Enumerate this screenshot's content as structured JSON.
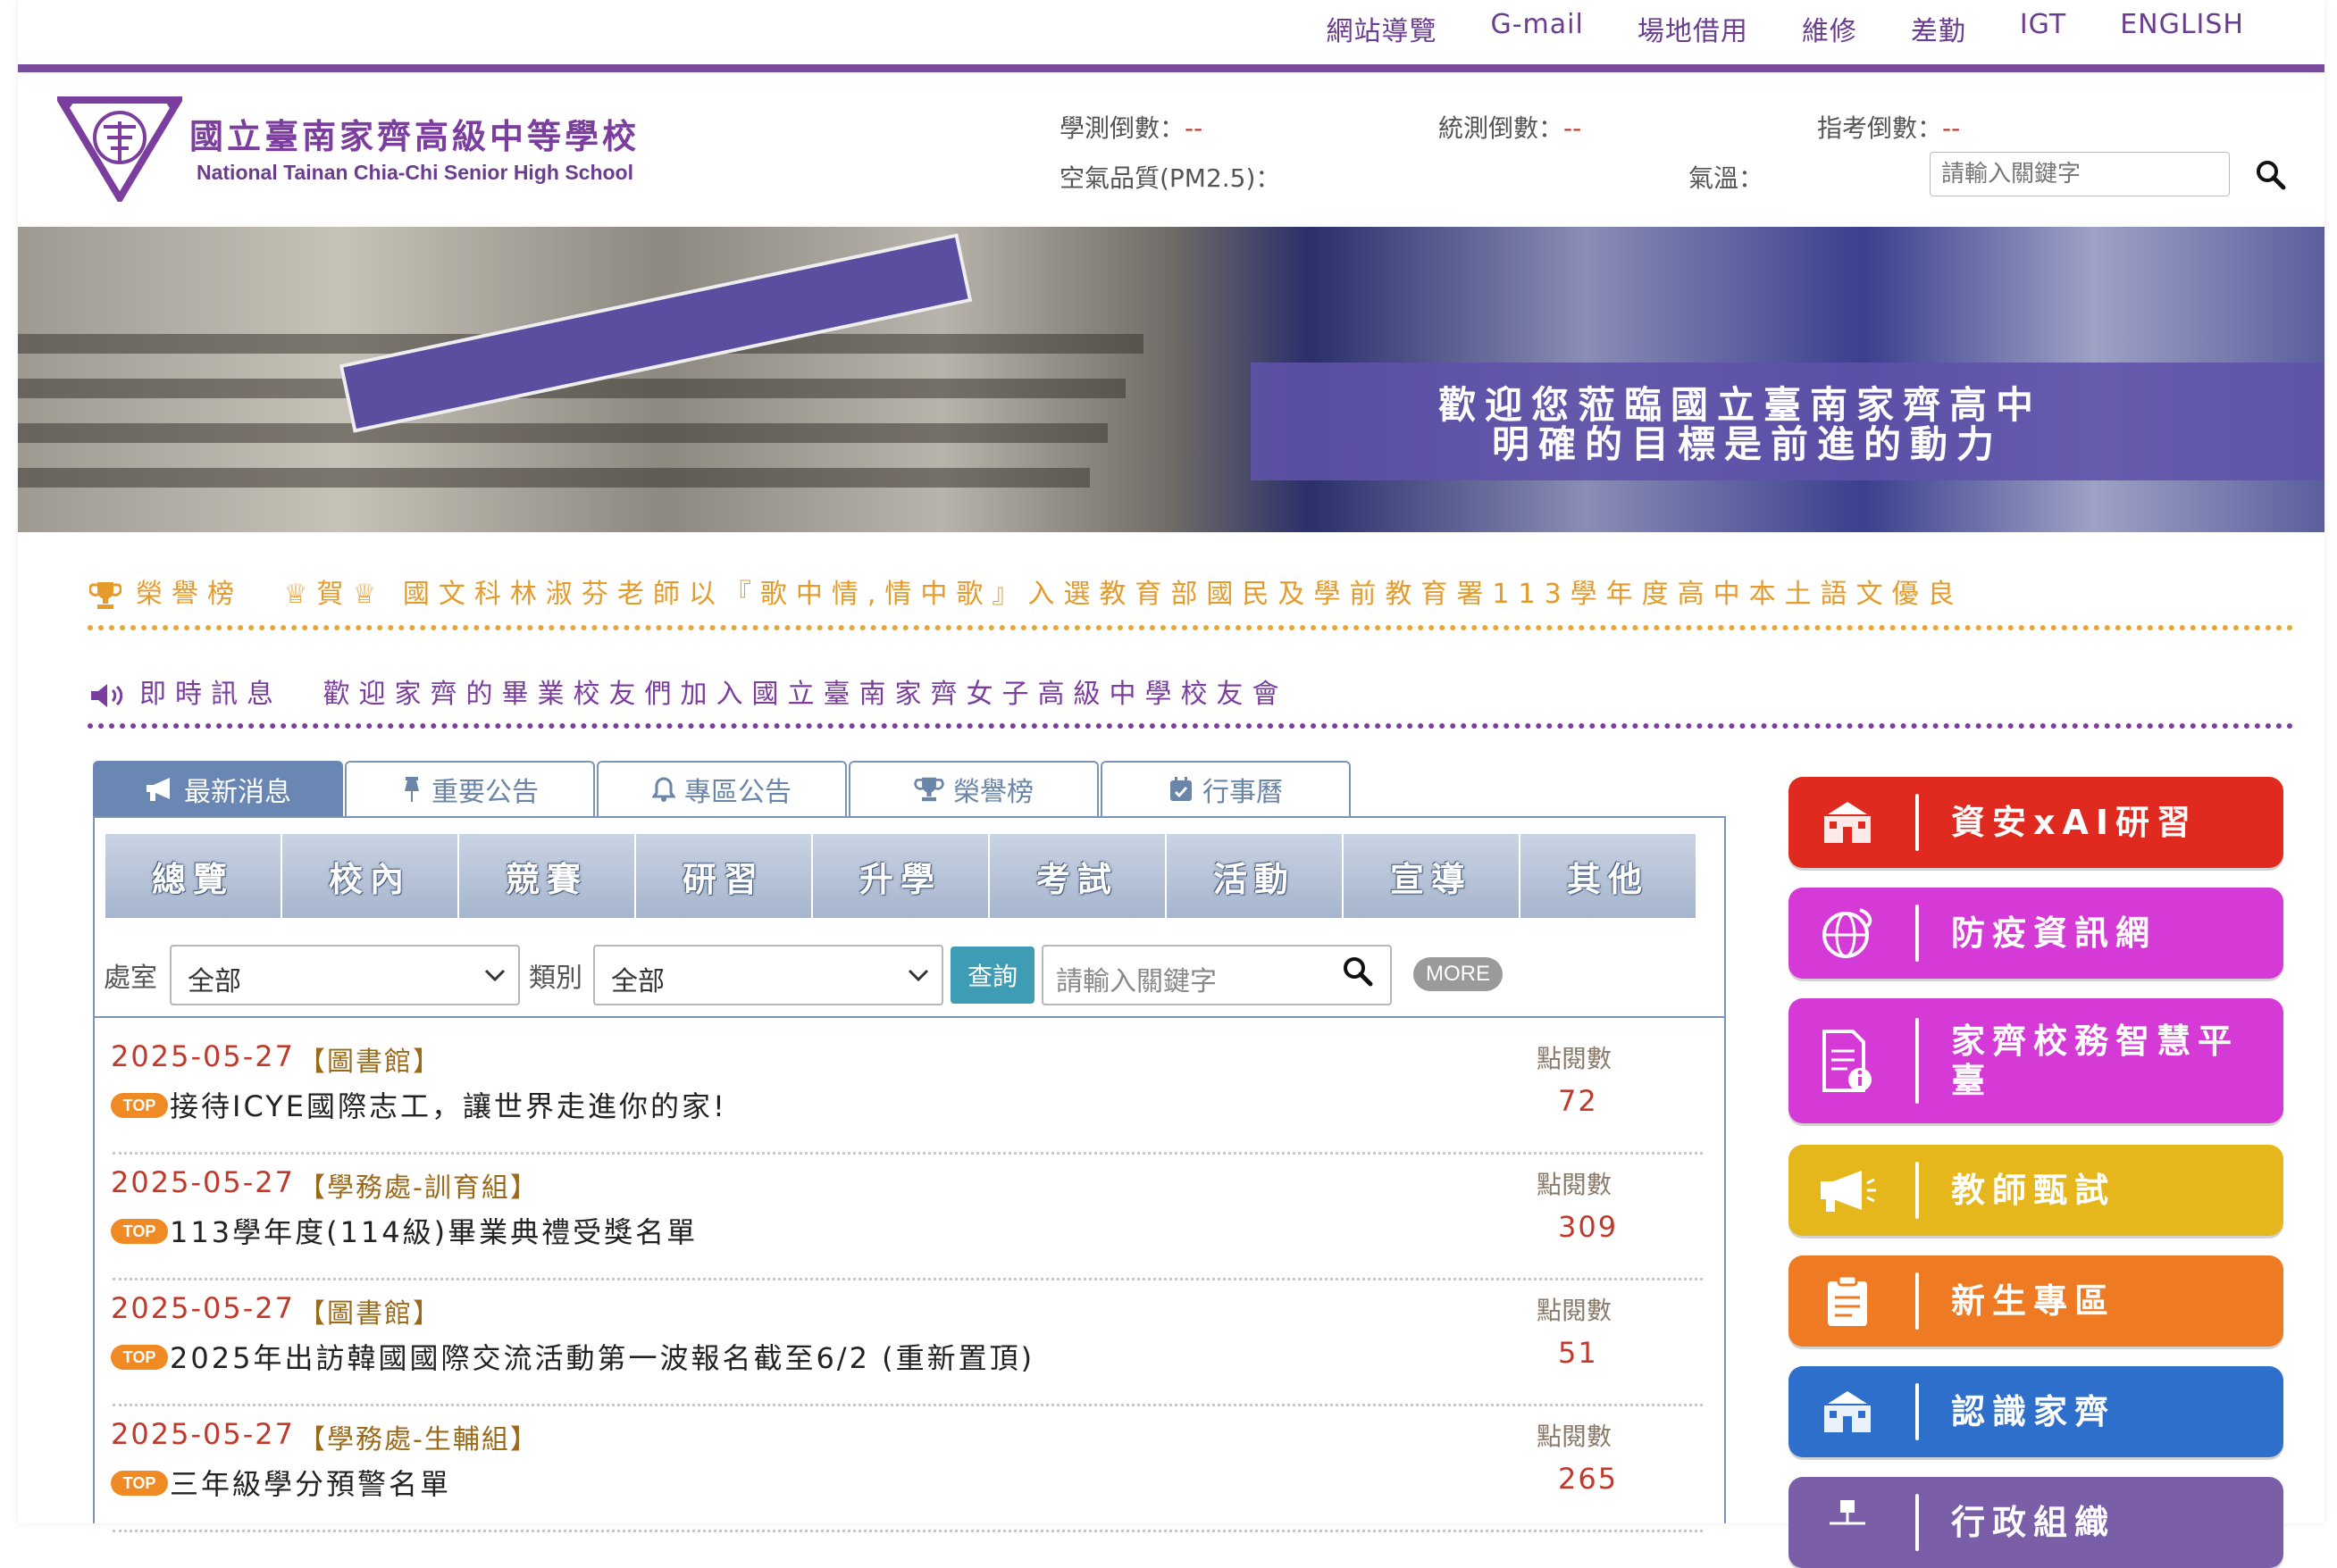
{
  "topnav": [
    "網站導覽",
    "G-mail",
    "場地借用",
    "維修",
    "差勤",
    "IGT",
    "ENGLISH"
  ],
  "header": {
    "school_zh": "國立臺南家齊高級中等學校",
    "school_en": "National Tainan Chia-Chi Senior High School",
    "countdown_gsat_label": "學測倒數：",
    "countdown_gsat_value": "--",
    "countdown_tvee_label": "統測倒數：",
    "countdown_tvee_value": "--",
    "countdown_ast_label": "指考倒數：",
    "countdown_ast_value": "--",
    "air_quality_label": "空氣品質(PM2.5)：",
    "temp_label": "氣溫：",
    "search_placeholder": "請輸入關鍵字"
  },
  "banner": {
    "caption_line1": "歡迎您蒞臨國立臺南家齊高中",
    "caption_line2": "明確的目標是前進的動力"
  },
  "marquee": {
    "honor_label": "榮譽榜",
    "honor_text": "♕賀♕ 國文科林淑芬老師以『歌中情,情中歌』入選教育部國民及學前教育署113學年度高中本土語文優良",
    "news_label": "即時訊息",
    "news_text": "歡迎家齊的畢業校友們加入國立臺南家齊女子高級中學校友會"
  },
  "tabs": [
    {
      "label": "最新消息",
      "icon": "megaphone-icon",
      "active": true
    },
    {
      "label": "重要公告",
      "icon": "pin-icon",
      "active": false
    },
    {
      "label": "專區公告",
      "icon": "bell-icon",
      "active": false
    },
    {
      "label": "榮譽榜",
      "icon": "trophy-icon",
      "active": false
    },
    {
      "label": "行事曆",
      "icon": "calendar-icon",
      "active": false
    }
  ],
  "categories": [
    "總覽",
    "校內",
    "競賽",
    "研習",
    "升學",
    "考試",
    "活動",
    "宣導",
    "其他"
  ],
  "filters": {
    "office_label": "處室",
    "office_value": "全部",
    "type_label": "類別",
    "type_value": "全部",
    "query_button": "查詢",
    "keyword_placeholder": "請輸入關鍵字",
    "more_button": "MORE"
  },
  "news": [
    {
      "date": "2025-05-27",
      "dept": "【圖書館】",
      "badge": "TOP",
      "title": "接待ICYE國際志工，讓世界走進你的家!",
      "clicks_label": "點閱數",
      "clicks": "72"
    },
    {
      "date": "2025-05-27",
      "dept": "【學務處-訓育組】",
      "badge": "TOP",
      "title": "113學年度(114級)畢業典禮受獎名單",
      "clicks_label": "點閱數",
      "clicks": "309"
    },
    {
      "date": "2025-05-27",
      "dept": "【圖書館】",
      "badge": "TOP",
      "title": "2025年出訪韓國國際交流活動第一波報名截至6/2 (重新置頂)",
      "clicks_label": "點閱數",
      "clicks": "51"
    },
    {
      "date": "2025-05-27",
      "dept": "【學務處-生輔組】",
      "badge": "TOP",
      "title": "三年級學分預警名單",
      "clicks_label": "點閱數",
      "clicks": "265"
    }
  ],
  "side_buttons": [
    {
      "label": "資安xAI研習",
      "color": "#e02a1f",
      "icon": "school-building-icon"
    },
    {
      "label": "防疫資訊網",
      "color": "#d63ad6",
      "icon": "globe-icon"
    },
    {
      "label": "家齊校務智慧平臺",
      "color": "#d63ad6",
      "icon": "document-info-icon"
    },
    {
      "label": "教師甄試",
      "color": "#e5b71c",
      "icon": "megaphone-icon"
    },
    {
      "label": "新生專區",
      "color": "#ee7a23",
      "icon": "clipboard-icon"
    },
    {
      "label": "認識家齊",
      "color": "#2f6fcc",
      "icon": "school-building-icon"
    },
    {
      "label": "行政組織",
      "color": "#7a5ea8",
      "icon": "org-chart-icon"
    }
  ]
}
